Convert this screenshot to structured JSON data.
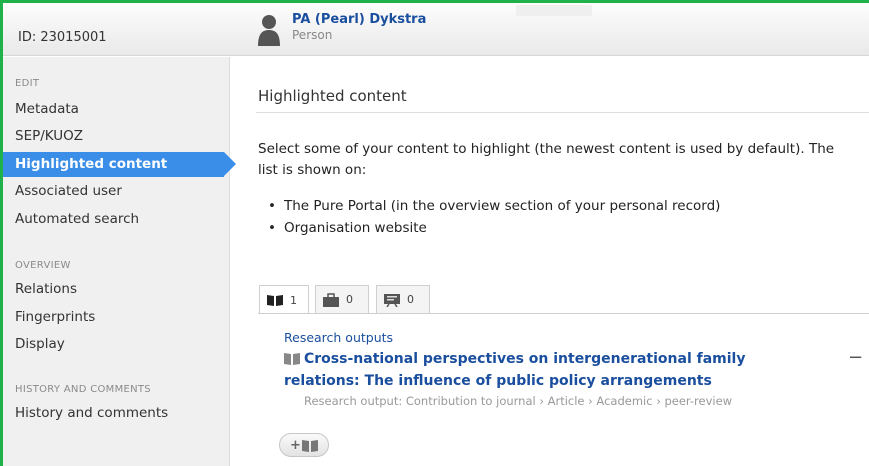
{
  "topbar": {
    "id_label": "ID: 23015001",
    "person_name": "PA (Pearl) Dykstra",
    "person_type": "Person"
  },
  "sidebar": {
    "edit_heading": "EDIT",
    "edit_items": [
      "Metadata",
      "SEP/KUOZ",
      "Highlighted content",
      "Associated user",
      "Automated search"
    ],
    "active_item": "Highlighted content",
    "overview_heading": "OVERVIEW",
    "overview_items": [
      "Relations",
      "Fingerprints",
      "Display"
    ],
    "history_heading": "HISTORY AND COMMENTS",
    "history_items": [
      "History and comments"
    ]
  },
  "main": {
    "heading": "Highlighted content",
    "description": "Select some of your content to highlight (the newest content is used by default). The list is shown on:",
    "bullets": [
      "The Pure Portal (in the overview section of your personal record)",
      "Organisation website"
    ],
    "tabs": [
      {
        "icon": "book-icon",
        "count": "1"
      },
      {
        "icon": "briefcase-icon",
        "count": "0"
      },
      {
        "icon": "presentation-icon",
        "count": "0"
      }
    ],
    "research_output": {
      "category": "Research outputs",
      "title": "Cross-national perspectives on intergenerational family relations: The influence of public policy arrangements",
      "meta": "Research output: Contribution to journal › Article › Academic › peer-review",
      "remove_label": "−"
    },
    "add_button_label": "+"
  },
  "colors": {
    "accent": "#3b8ee8",
    "link": "#1a4e9e",
    "frame": "#1fb24a"
  }
}
